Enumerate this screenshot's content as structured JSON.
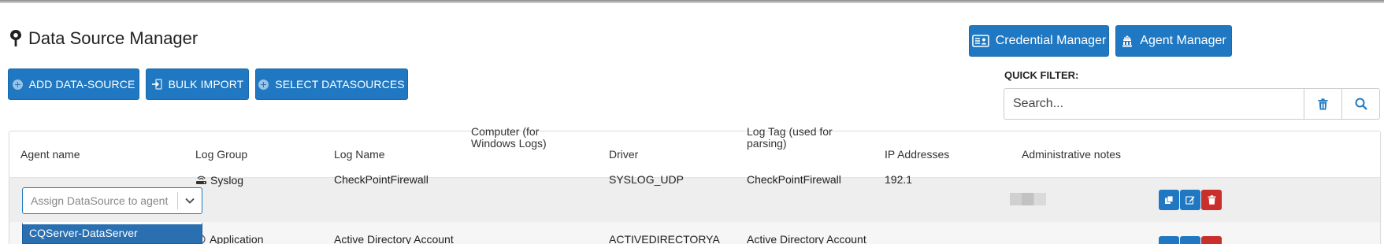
{
  "page": {
    "title": "Data Source Manager"
  },
  "header_buttons": {
    "credential_manager": "Credential Manager",
    "agent_manager": "Agent Manager"
  },
  "actions": {
    "add_datasource": "ADD DATA-SOURCE",
    "bulk_import": "BULK IMPORT",
    "select_datasources": "SELECT DATASOURCES"
  },
  "quick_filter": {
    "label": "QUICK FILTER:",
    "placeholder": "Search..."
  },
  "table": {
    "columns": [
      "Agent name",
      "Log Group",
      "Log Name",
      "Computer (for Windows Logs)",
      "Driver",
      "Log Tag (used for parsing)",
      "IP Addresses",
      "Administrative notes"
    ],
    "rows": [
      {
        "agent_placeholder": "Assign DataSource to agent",
        "log_group": "Syslog",
        "log_name": "CheckPointFirewall",
        "computer": "",
        "driver": "SYSLOG_UDP",
        "log_tag": "CheckPointFirewall",
        "ip_address": "192.1"
      },
      {
        "log_group": "Application",
        "log_name": "Active Directory Account",
        "driver": "ACTIVEDIRECTORYA",
        "log_tag": "Active Directory Account"
      }
    ]
  },
  "agent_dropdown": {
    "option": "CQServer-DataServer"
  },
  "colors": {
    "primary": "#1f78c1",
    "danger": "#c9302c",
    "row_highlight": "#eeeeee"
  },
  "icons": [
    "map-pin-icon",
    "id-card-icon",
    "agent-building-icon",
    "plus-circle-icon",
    "import-icon",
    "trash-icon",
    "search-icon",
    "chevron-down-icon",
    "syslog-icon",
    "copy-icon",
    "edit-icon",
    "delete-icon"
  ]
}
